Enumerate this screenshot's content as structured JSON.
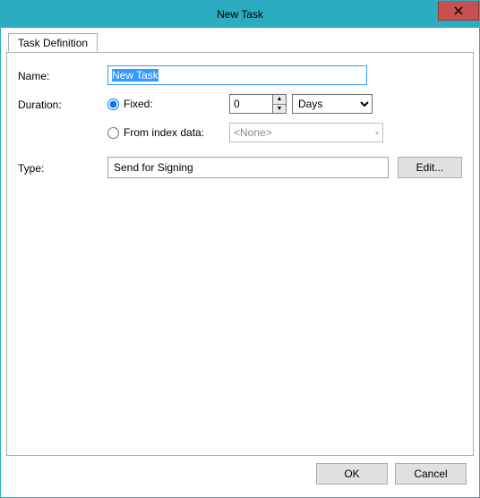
{
  "window": {
    "title": "New Task"
  },
  "tabs": {
    "definition": "Task Definition"
  },
  "labels": {
    "name": "Name:",
    "duration": "Duration:",
    "type": "Type:"
  },
  "fields": {
    "name_value": "New Task",
    "fixed_label": "Fixed:",
    "fixed_value": "0",
    "unit_options": [
      "Days"
    ],
    "unit_selected": "Days",
    "from_index_label": "From index data:",
    "from_index_value": "<None>",
    "type_value": "Send for Signing"
  },
  "buttons": {
    "edit": "Edit...",
    "ok": "OK",
    "cancel": "Cancel"
  }
}
